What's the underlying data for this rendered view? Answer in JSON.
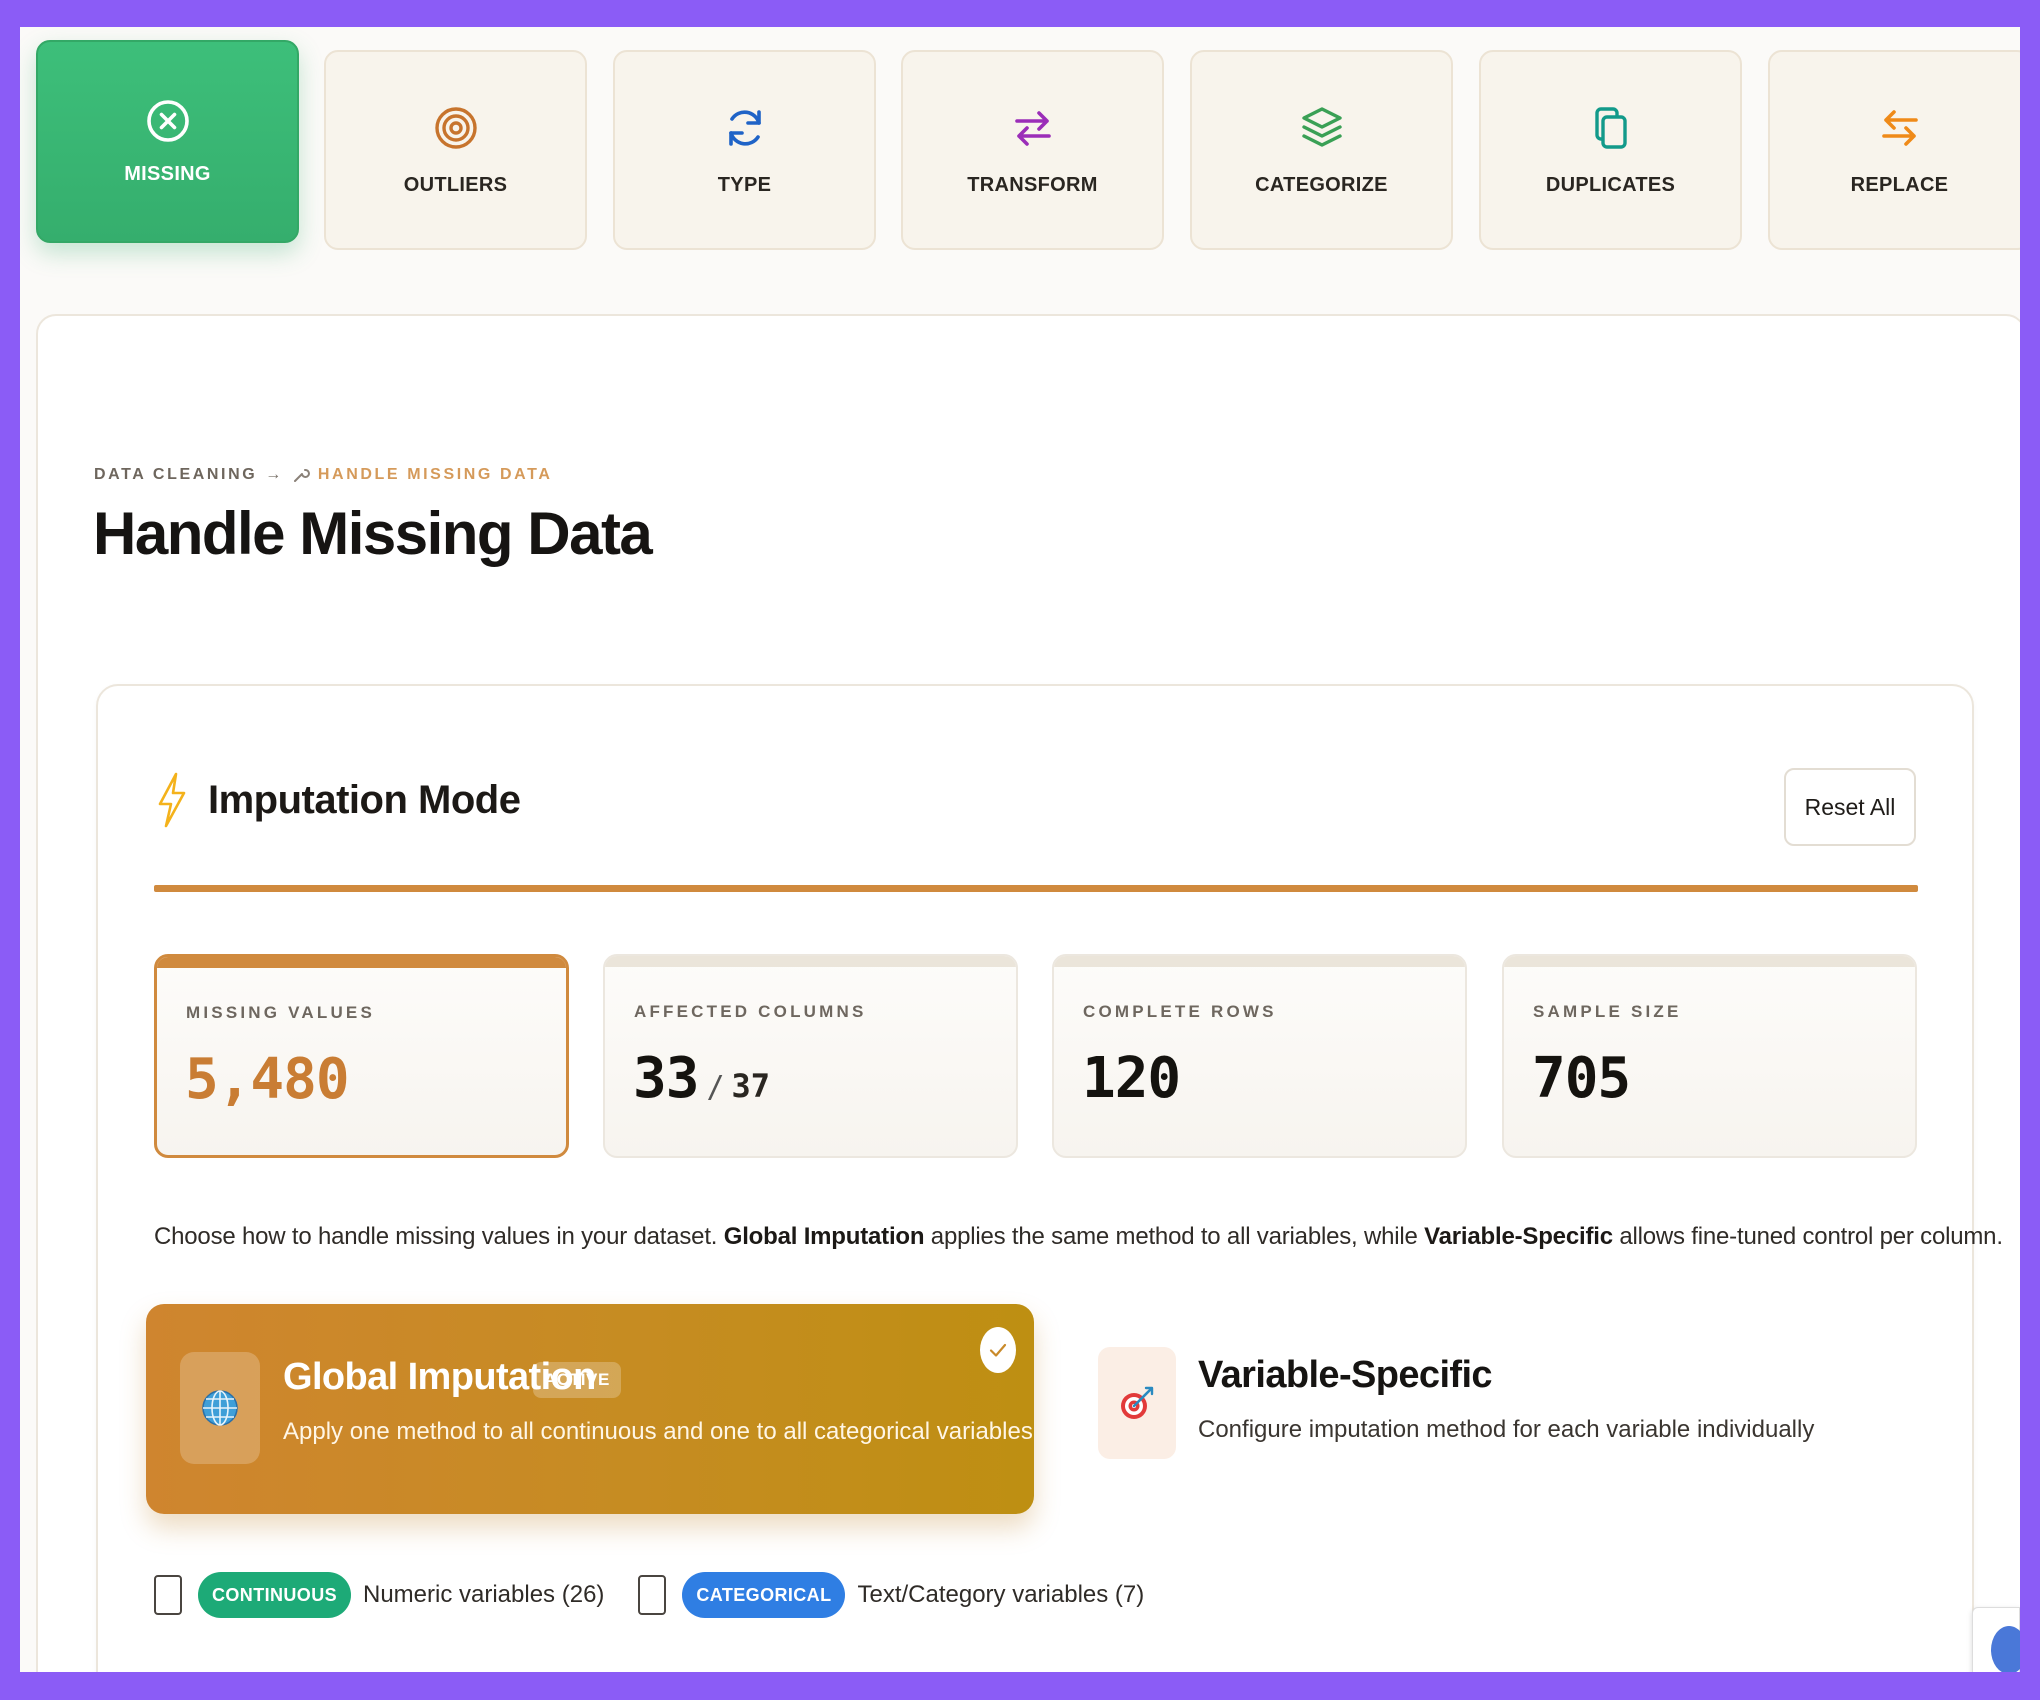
{
  "tabs": [
    {
      "id": "missing",
      "label": "MISSING",
      "icon": "circle-x-icon",
      "color": "#ffffff",
      "active": true
    },
    {
      "id": "outliers",
      "label": "OUTLIERS",
      "icon": "target-icon",
      "color": "#c7742d"
    },
    {
      "id": "type",
      "label": "TYPE",
      "icon": "refresh-icon",
      "color": "#1f63c7"
    },
    {
      "id": "transform",
      "label": "TRANSFORM",
      "icon": "swap-icon",
      "color": "#9b2db8"
    },
    {
      "id": "categorize",
      "label": "CATEGORIZE",
      "icon": "layers-icon",
      "color": "#3aa055"
    },
    {
      "id": "duplicates",
      "label": "DUPLICATES",
      "icon": "copy-icon",
      "color": "#129a8a"
    },
    {
      "id": "replace",
      "label": "REPLACE",
      "icon": "replace-icon",
      "color": "#ef8a18"
    }
  ],
  "breadcrumb": {
    "root": "DATA CLEANING",
    "separator": "→",
    "current": "HANDLE MISSING DATA",
    "current_icon": "wrench-icon"
  },
  "page_title": "Handle Missing Data",
  "imputation": {
    "title": "Imputation Mode",
    "title_icon": "lightning-icon",
    "reset_label": "Reset All",
    "accent_color": "#d08a3e"
  },
  "stats": [
    {
      "label": "MISSING VALUES",
      "value": "5,480",
      "highlight": true
    },
    {
      "label": "AFFECTED COLUMNS",
      "value": "33",
      "slash": "/",
      "sub": "37"
    },
    {
      "label": "COMPLETE ROWS",
      "value": "120"
    },
    {
      "label": "SAMPLE SIZE",
      "value": "705"
    }
  ],
  "description": {
    "p1": "Choose how to handle missing values in your dataset. ",
    "b1": "Global Imputation",
    "p2": " applies the same method to all variables, while ",
    "b2": "Variable-Specific",
    "p3": " allows fine-tuned control per column."
  },
  "modes": {
    "global": {
      "title": "Global Imputation",
      "badge": "ACTIVE",
      "description": "Apply one method to all continuous and one to all categorical variables",
      "icon": "globe-icon",
      "selected": true
    },
    "variable": {
      "title": "Variable-Specific",
      "description": "Configure imputation method for each variable individually",
      "icon": "dart-target-icon"
    }
  },
  "filters": [
    {
      "pill": "CONTINUOUS",
      "label": "Numeric variables (26)",
      "color": "#1daa77"
    },
    {
      "pill": "CATEGORICAL",
      "label": "Text/Category variables (7)",
      "color": "#2f7ee3"
    }
  ]
}
